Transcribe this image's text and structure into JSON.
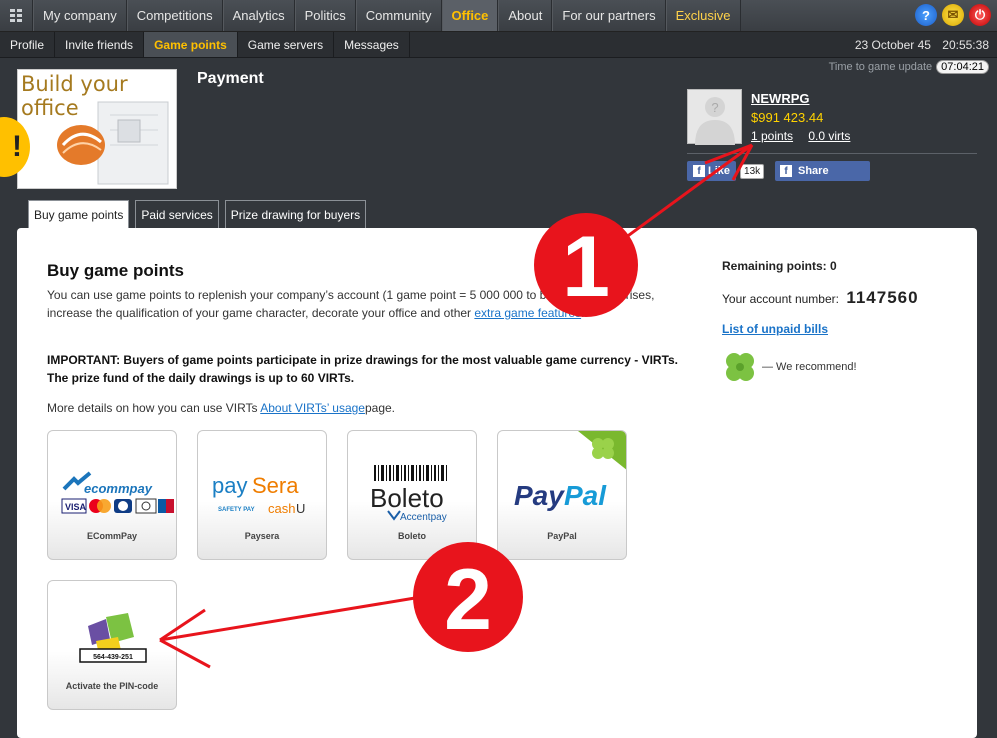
{
  "topnav": {
    "items": [
      "My company",
      "Competitions",
      "Analytics",
      "Politics",
      "Community",
      "Office",
      "About",
      "For our partners",
      "Exclusive"
    ],
    "active": "Office"
  },
  "subnav": {
    "items": [
      "Profile",
      "Invite friends",
      "Game points",
      "Game servers",
      "Messages"
    ],
    "active": "Game points",
    "date": "23 October 45",
    "time": "20:55:38"
  },
  "update": {
    "label": "Time to game update",
    "timer": "07:04:21"
  },
  "office": {
    "title": "Build your office",
    "badge": "!"
  },
  "page_title": "Payment",
  "user": {
    "name": "NEWRPG",
    "money": "$991 423.44",
    "points": "1 points",
    "virts": "0.0 virts"
  },
  "social": {
    "like": "Like",
    "like_count": "13k",
    "share": "Share"
  },
  "tabs": [
    "Buy game points",
    "Paid services",
    "Prize drawing for buyers"
  ],
  "main": {
    "heading": "Buy game points",
    "para_pre": "You can use game points to replenish your company’s account (1 game point = 5 000 000",
    "para_mid": "to buy state enterprises, increase the qualification of your game character, decorate your office and other",
    "para_link": "extra game features",
    "important": "IMPORTANT: Buyers of game points participate in prize drawings for the most valuable game currency - VIRTs. The prize fund of the daily drawings is up to 60 VIRTs.",
    "more_pre": "More details on how you can use VIRTs",
    "more_link": "About VIRTs’ usage",
    "more_post": "page."
  },
  "payments": [
    {
      "name": "ECommPay",
      "logo": "ecommpay"
    },
    {
      "name": "Paysera",
      "logo": "paysera"
    },
    {
      "name": "Boleto",
      "logo": "boleto"
    },
    {
      "name": "PayPal",
      "logo": "paypal"
    },
    {
      "name": "Activate the PIN-code",
      "logo": "pin",
      "pin": "564-439-251"
    }
  ],
  "sidebar": {
    "remaining": "Remaining points: 0",
    "account_label": "Your account number:",
    "account_number": "1147560",
    "unpaid": "List of unpaid bills",
    "recommend": "— We recommend!"
  },
  "annotations": [
    "1",
    "2"
  ],
  "colors": {
    "accent": "#ffc000",
    "link": "#1a73c8",
    "annotation": "#e8141c",
    "facebook": "#4a67a8"
  }
}
